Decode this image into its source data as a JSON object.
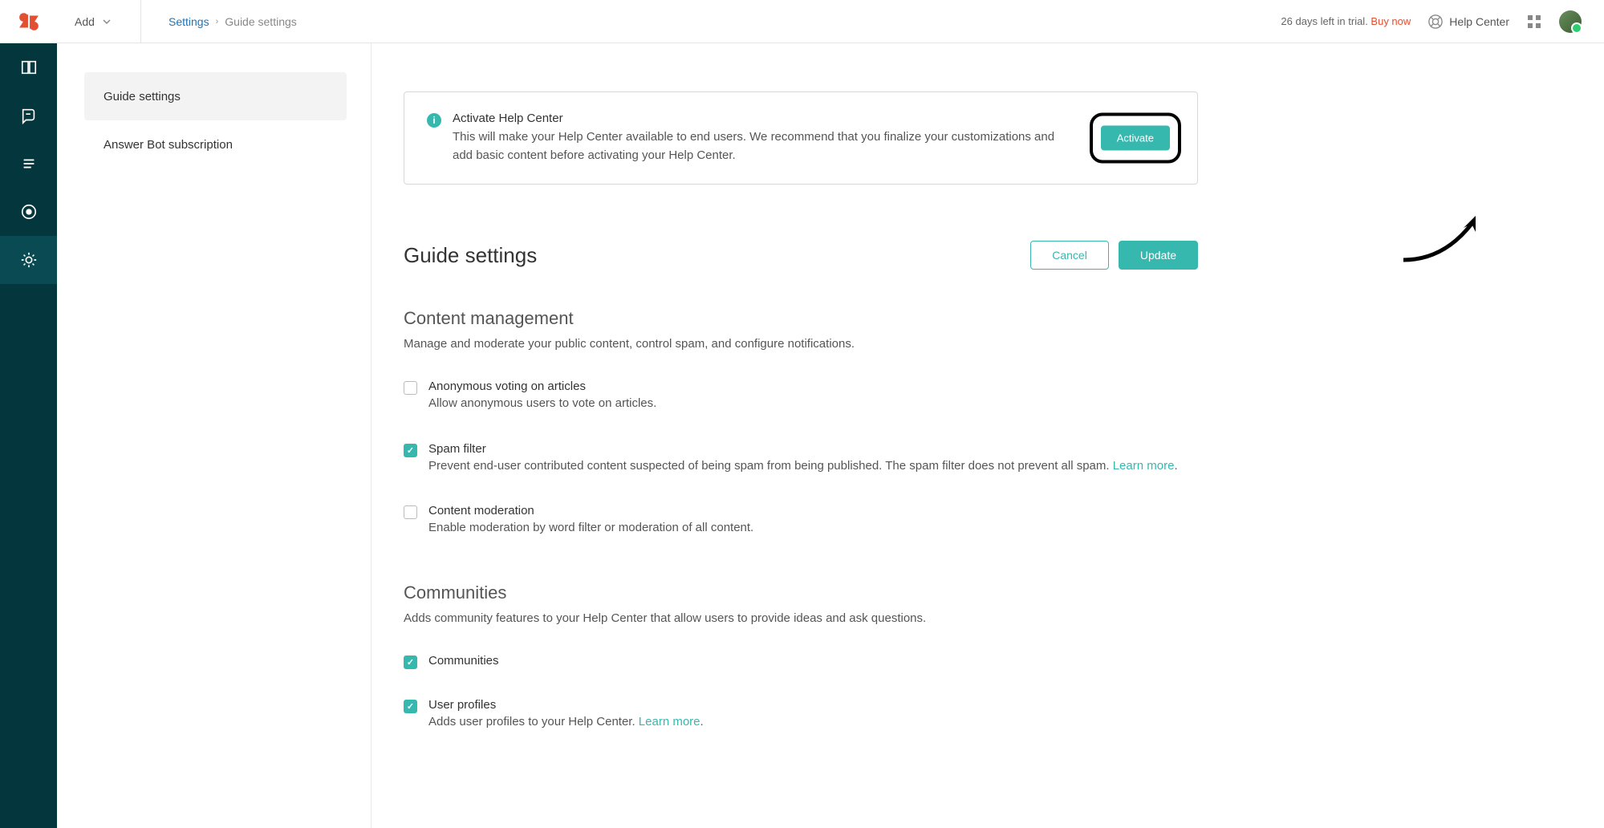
{
  "topbar": {
    "add_label": "Add",
    "breadcrumb_root": "Settings",
    "breadcrumb_current": "Guide settings",
    "trial_text": "26 days left in trial. ",
    "buy_label": "Buy now",
    "help_center_label": "Help Center"
  },
  "subnav": {
    "items": [
      {
        "label": "Guide settings"
      },
      {
        "label": "Answer Bot subscription"
      }
    ]
  },
  "alert": {
    "title": "Activate Help Center",
    "desc": "This will make your Help Center available to end users. We recommend that you finalize your customizations and add basic content before activating your Help Center.",
    "button": "Activate"
  },
  "page": {
    "title": "Guide settings",
    "cancel": "Cancel",
    "update": "Update"
  },
  "sections": {
    "content_mgmt": {
      "title": "Content management",
      "desc": "Manage and moderate your public content, control spam, and configure notifications.",
      "anon_title": "Anonymous voting on articles",
      "anon_desc": "Allow anonymous users to vote on articles.",
      "spam_title": "Spam filter",
      "spam_desc_pre": "Prevent end-user contributed content suspected of being spam from being published. The spam filter does not prevent all spam. ",
      "spam_learn": "Learn more",
      "mod_title": "Content moderation",
      "mod_desc": "Enable moderation by word filter or moderation of all content."
    },
    "communities": {
      "title": "Communities",
      "desc": "Adds community features to your Help Center that allow users to provide ideas and ask questions.",
      "comm_title": "Communities",
      "user_title": "User profiles",
      "user_desc_pre": "Adds user profiles to your Help Center. ",
      "user_learn": "Learn more"
    }
  },
  "period": "."
}
